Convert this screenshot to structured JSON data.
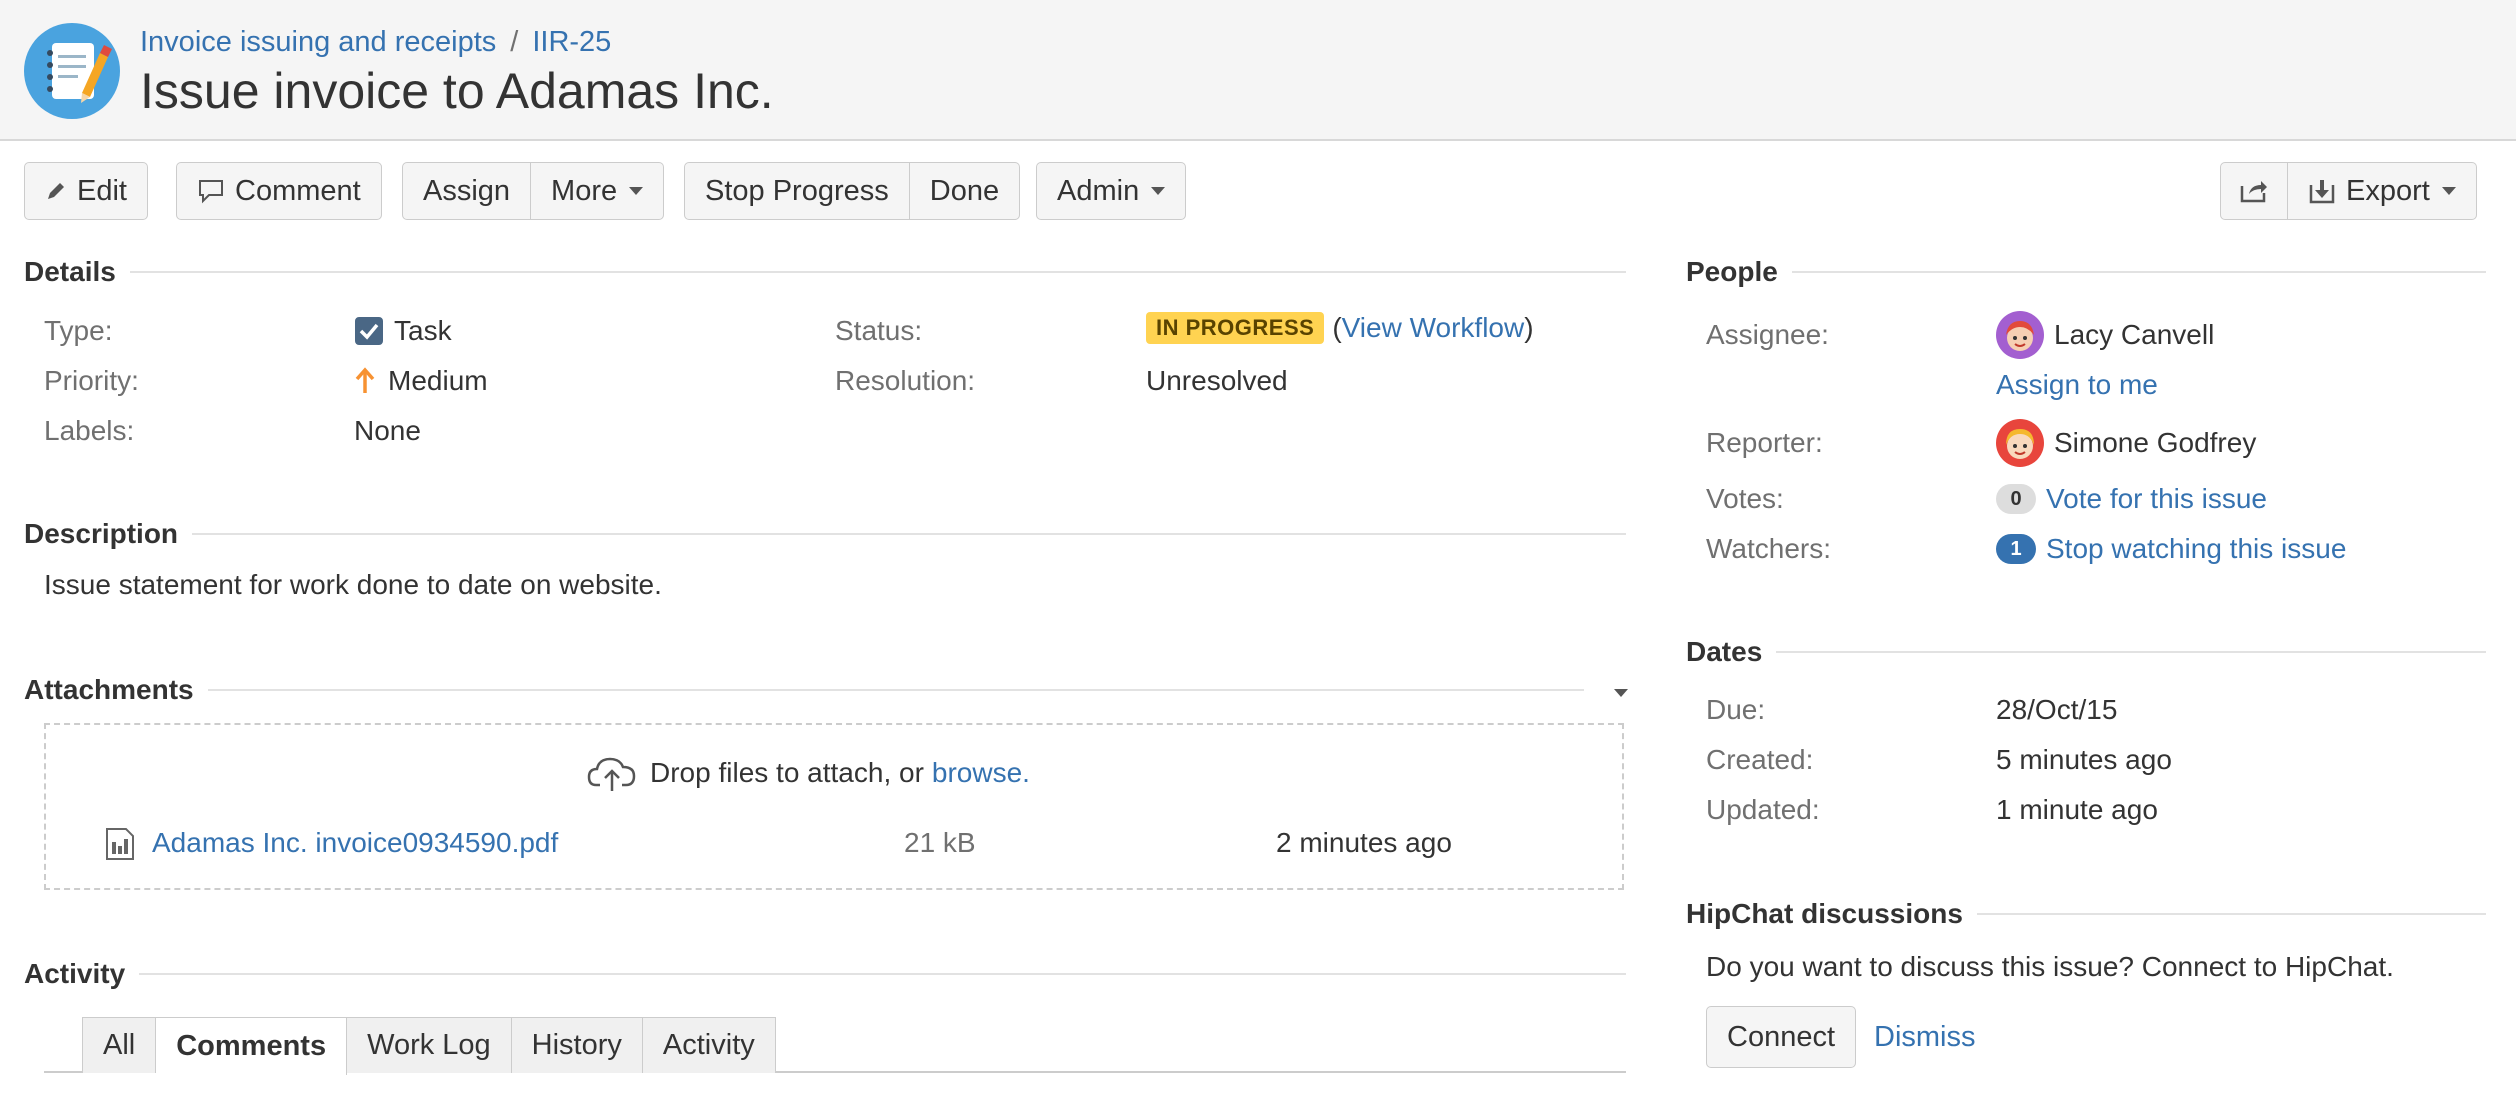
{
  "breadcrumb": {
    "project": "Invoice issuing and receipts",
    "separator": "/",
    "issue_key": "IIR-25"
  },
  "issue": {
    "title": "Issue invoice to Adamas Inc."
  },
  "toolbar": {
    "edit": "Edit",
    "comment": "Comment",
    "assign": "Assign",
    "more": "More",
    "stop_progress": "Stop Progress",
    "done": "Done",
    "admin": "Admin",
    "export": "Export"
  },
  "details": {
    "heading": "Details",
    "type_label": "Type:",
    "type_value": "Task",
    "priority_label": "Priority:",
    "priority_value": "Medium",
    "labels_label": "Labels:",
    "labels_value": "None",
    "status_label": "Status:",
    "status_value": "IN PROGRESS",
    "view_workflow_open": "(",
    "view_workflow": "View Workflow",
    "view_workflow_close": ")",
    "resolution_label": "Resolution:",
    "resolution_value": "Unresolved"
  },
  "description": {
    "heading": "Description",
    "text": "Issue statement for work done to date on website."
  },
  "attachments": {
    "heading": "Attachments",
    "drop_text": "Drop files to attach, or",
    "browse": "browse.",
    "files": [
      {
        "name": "Adamas Inc. invoice0934590.pdf",
        "size": "21 kB",
        "date": "2 minutes ago"
      }
    ]
  },
  "activity": {
    "heading": "Activity",
    "tabs": [
      "All",
      "Comments",
      "Work Log",
      "History",
      "Activity"
    ],
    "active_tab": "Comments"
  },
  "people": {
    "heading": "People",
    "assignee_label": "Assignee:",
    "assignee": "Lacy Canvell",
    "assign_to_me": "Assign to me",
    "reporter_label": "Reporter:",
    "reporter": "Simone Godfrey",
    "votes_label": "Votes:",
    "votes_count": "0",
    "vote_link": "Vote for this issue",
    "watchers_label": "Watchers:",
    "watchers_count": "1",
    "watch_link": "Stop watching this issue"
  },
  "dates": {
    "heading": "Dates",
    "due_label": "Due:",
    "due": "28/Oct/15",
    "created_label": "Created:",
    "created": "5 minutes ago",
    "updated_label": "Updated:",
    "updated": "1 minute ago"
  },
  "hipchat": {
    "heading": "HipChat discussions",
    "text": "Do you want to discuss this issue? Connect to HipChat.",
    "connect": "Connect",
    "dismiss": "Dismiss"
  },
  "colors": {
    "link": "#3572b0",
    "status_lozenge": "#ffd351",
    "priority_arrow": "#f79232",
    "task_checkbox": "#4a6785"
  },
  "icons": {
    "project": "notepad-pencil-icon",
    "edit": "pencil-icon",
    "comment": "speech-bubble-icon",
    "share": "share-icon",
    "export": "download-icon",
    "upload": "cloud-upload-icon",
    "file": "document-icon"
  }
}
